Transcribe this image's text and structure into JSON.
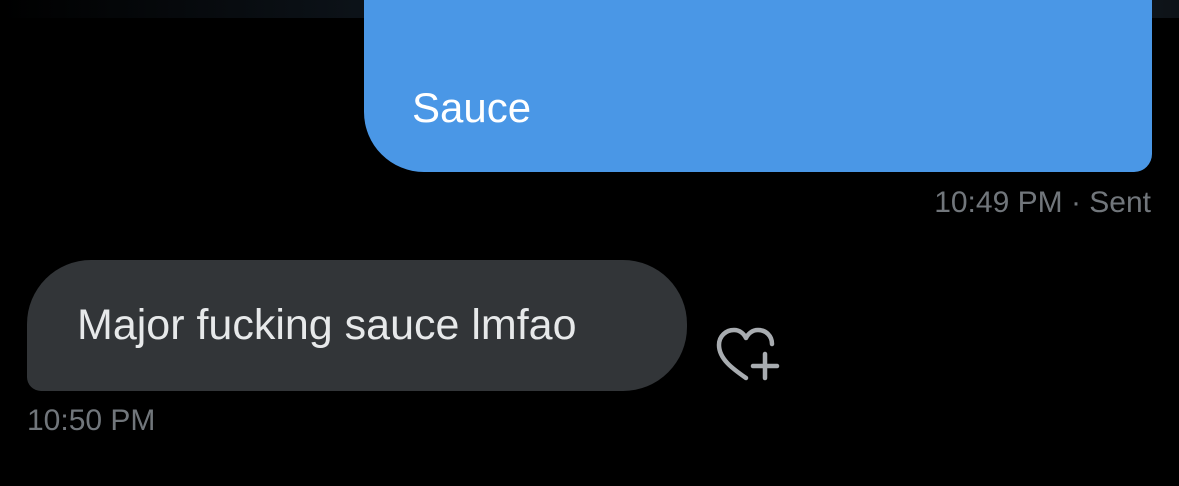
{
  "messages": {
    "sent": {
      "text": "Sauce",
      "time": "10:49 PM",
      "separator": " · ",
      "status": "Sent"
    },
    "received": {
      "text": "Major fucking sauce lmfao",
      "time": "10:50 PM"
    }
  },
  "icons": {
    "reaction": "heart-plus-icon"
  },
  "colors": {
    "background": "#000000",
    "sent_bubble": "#4a97e6",
    "received_bubble": "#323538",
    "meta_text": "#71767b",
    "received_text": "#e7e9ea"
  }
}
